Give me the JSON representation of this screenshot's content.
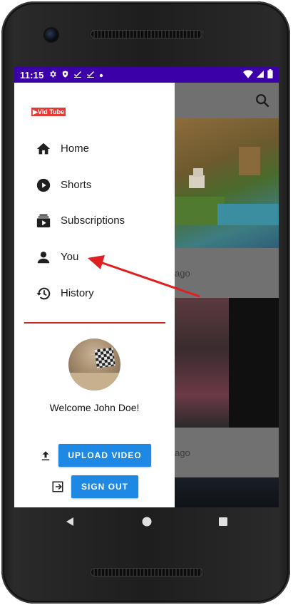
{
  "statusbar": {
    "time": "11:15",
    "left_icons": [
      "gear-icon",
      "shield-icon",
      "check-icon",
      "check-icon",
      "dot-icon"
    ],
    "right_icons": [
      "wifi-icon",
      "signal-icon",
      "battery-icon"
    ],
    "color": "#3b00a8"
  },
  "drawer": {
    "logo": "▶Vid Tube",
    "nav": [
      {
        "label": "Home",
        "icon": "home-icon"
      },
      {
        "label": "Shorts",
        "icon": "play-circle-icon"
      },
      {
        "label": "Subscriptions",
        "icon": "subscriptions-icon"
      },
      {
        "label": "You",
        "icon": "person-icon"
      },
      {
        "label": "History",
        "icon": "history-icon"
      }
    ],
    "welcome": "Welcome John Doe!",
    "upload_label": "UPLOAD VIDEO",
    "signout_label": "SIGN OUT"
  },
  "background": {
    "ago_1": "ago",
    "ago_2": "ago"
  },
  "colors": {
    "accent_button": "#1e88e5",
    "divider": "#c62828",
    "annotation_arrow": "#e02020"
  }
}
